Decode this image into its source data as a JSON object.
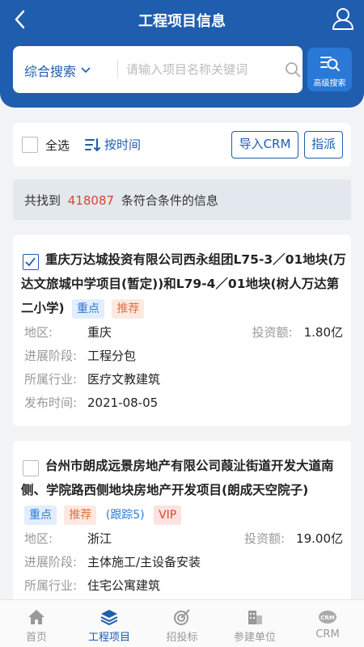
{
  "header": {
    "title": "工程项目信息"
  },
  "search": {
    "combo_label": "综合搜索",
    "placeholder": "请输入项目名称关键词",
    "advanced_label": "高级搜索"
  },
  "toolbar": {
    "select_all": "全选",
    "sort_label": "按时间",
    "import_label": "导入CRM",
    "assign_label": "指派"
  },
  "result": {
    "prefix": "共找到",
    "count": "418087",
    "suffix": "条符合条件的信息"
  },
  "projects": [
    {
      "title": "重庆万达城投资有限公司西永组团L75-3／01地块(万达文旅城中学项目(暂定))和L79-4／01地块(树人万达第二小学)",
      "checked": true,
      "tags": {
        "key": "重点",
        "recommend": "推荐"
      },
      "region_label": "地区:",
      "region": "重庆",
      "invest_label": "投资额:",
      "invest": "1.80亿",
      "stage_label": "进展阶段:",
      "stage": "工程分包",
      "industry_label": "所属行业:",
      "industry": "医疗文教建筑",
      "date_label": "发布时间:",
      "date": "2021-08-05"
    },
    {
      "title": "台州市朗成远景房地产有限公司葭沚街道开发大道南侧、学院路西侧地块房地产开发项目(朗成天空院子)",
      "checked": false,
      "tags": {
        "key": "重点",
        "recommend": "推荐",
        "track": "(跟踪5)",
        "vip": "VIP"
      },
      "region_label": "地区:",
      "region": "浙江",
      "invest_label": "投资额:",
      "invest": "19.00亿",
      "stage_label": "进展阶段:",
      "stage": "主体施工/主设备安装",
      "industry_label": "所属行业:",
      "industry": "住宅公寓建筑"
    }
  ],
  "tabs": [
    {
      "label": "首页",
      "icon": "home-icon"
    },
    {
      "label": "工程项目",
      "icon": "layers-icon",
      "active": true
    },
    {
      "label": "招投标",
      "icon": "target-icon"
    },
    {
      "label": "参建单位",
      "icon": "building-icon"
    },
    {
      "label": "CRM",
      "icon": "crm-icon"
    }
  ],
  "colors": {
    "primary": "#1f5dae",
    "accent": "#2a79d6",
    "highlight": "#d9482b"
  }
}
